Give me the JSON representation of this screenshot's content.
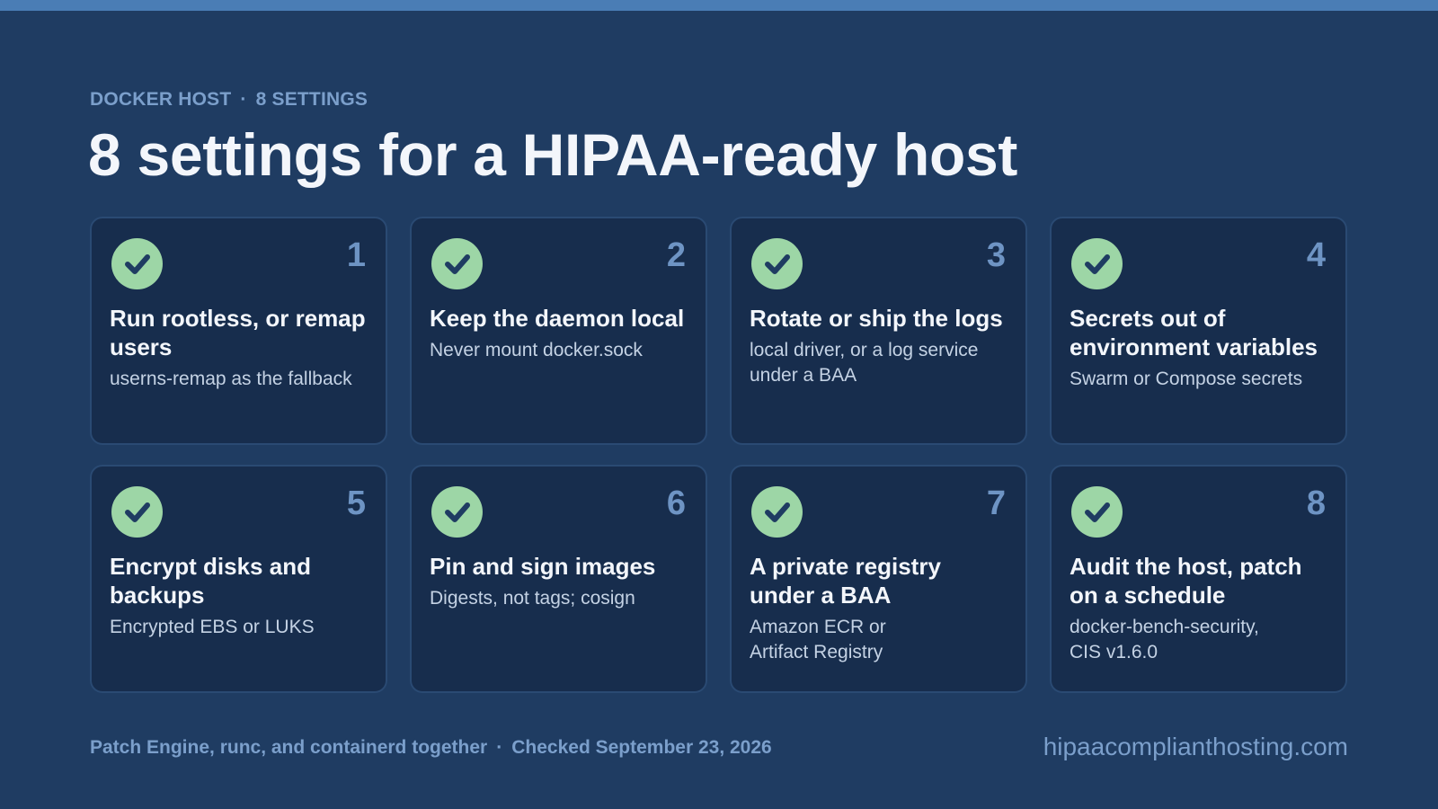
{
  "header": {
    "eyebrow_left": "DOCKER HOST",
    "eyebrow_separator": "·",
    "eyebrow_right": "8 SETTINGS",
    "title": "8 settings for a HIPAA-ready host"
  },
  "cards": [
    {
      "number": "1",
      "title": "Run rootless, or remap users",
      "desc": "userns-remap as the fallback",
      "icon": "check-circle-icon"
    },
    {
      "number": "2",
      "title": "Keep the daemon local",
      "desc": "Never mount docker.sock",
      "icon": "check-circle-icon"
    },
    {
      "number": "3",
      "title": "Rotate or ship the logs",
      "desc": "local driver, or a log service under a BAA",
      "icon": "check-circle-icon"
    },
    {
      "number": "4",
      "title": "Secrets out of environment variables",
      "desc": "Swarm or Compose secrets",
      "icon": "check-circle-icon"
    },
    {
      "number": "5",
      "title": "Encrypt disks and backups",
      "desc": "Encrypted EBS or LUKS",
      "icon": "check-circle-icon"
    },
    {
      "number": "6",
      "title": "Pin and sign images",
      "desc": "Digests, not tags; cosign",
      "icon": "check-circle-icon"
    },
    {
      "number": "7",
      "title": "A private registry under a BAA",
      "desc": "Amazon ECR or Artifact Registry",
      "icon": "check-circle-icon"
    },
    {
      "number": "8",
      "title": "Audit the host, patch on a schedule",
      "desc": "docker-bench-security, CIS v1.6.0",
      "icon": "check-circle-icon"
    }
  ],
  "footer": {
    "note": "Patch Engine, runc, and containerd together",
    "separator": "·",
    "checked": "Checked September 23, 2026",
    "site": "hipaacomplianthosting.com"
  },
  "colors": {
    "background": "#1f3c62",
    "accent_bar": "#4a7db5",
    "card": "#172d4d",
    "check": "#9dd6a6",
    "number": "#6e94c4"
  }
}
